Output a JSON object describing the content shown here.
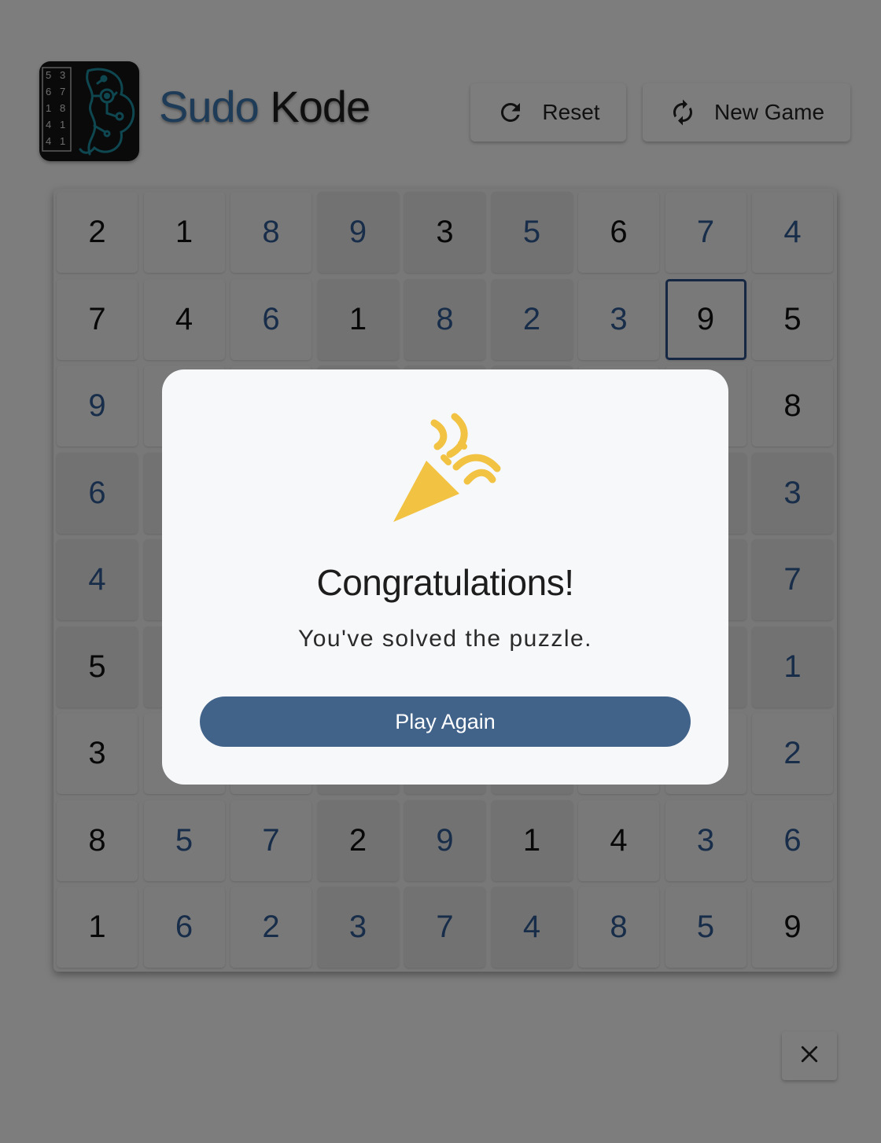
{
  "header": {
    "brand_part1": "Sudo",
    "brand_part2": "Kode",
    "reset_label": "Reset",
    "new_game_label": "New Game"
  },
  "logo": {
    "rows": [
      [
        "5",
        "3"
      ],
      [
        "6",
        "7"
      ],
      [
        "1",
        "8"
      ],
      [
        "4",
        "1"
      ],
      [
        "4",
        "1"
      ]
    ]
  },
  "board": {
    "values": [
      [
        2,
        1,
        8,
        9,
        3,
        5,
        6,
        7,
        4
      ],
      [
        7,
        4,
        6,
        1,
        8,
        2,
        3,
        9,
        5
      ],
      [
        9,
        null,
        null,
        null,
        null,
        null,
        null,
        null,
        8
      ],
      [
        6,
        null,
        null,
        null,
        null,
        null,
        null,
        null,
        3
      ],
      [
        4,
        null,
        null,
        null,
        null,
        null,
        null,
        null,
        7
      ],
      [
        5,
        null,
        null,
        null,
        null,
        null,
        null,
        null,
        1
      ],
      [
        3,
        null,
        null,
        null,
        null,
        null,
        null,
        null,
        2
      ],
      [
        8,
        5,
        7,
        2,
        9,
        1,
        4,
        3,
        6
      ],
      [
        1,
        6,
        2,
        3,
        7,
        4,
        8,
        5,
        9
      ]
    ],
    "given": [
      [
        1,
        1,
        0,
        0,
        1,
        0,
        1,
        0,
        0
      ],
      [
        1,
        1,
        0,
        1,
        0,
        0,
        0,
        1,
        1
      ],
      [
        0,
        0,
        0,
        0,
        0,
        0,
        0,
        0,
        1
      ],
      [
        0,
        0,
        0,
        0,
        0,
        0,
        0,
        0,
        0
      ],
      [
        0,
        0,
        0,
        0,
        0,
        0,
        0,
        0,
        0
      ],
      [
        1,
        0,
        0,
        0,
        0,
        0,
        0,
        0,
        0
      ],
      [
        1,
        0,
        0,
        0,
        0,
        0,
        0,
        0,
        0
      ],
      [
        1,
        0,
        0,
        1,
        0,
        1,
        1,
        0,
        0
      ],
      [
        1,
        0,
        0,
        0,
        0,
        0,
        0,
        0,
        1
      ]
    ],
    "selected": [
      1,
      7
    ],
    "colors": {
      "given": "#111111",
      "entered": "#2f5a92",
      "selected_border": "#2b4f86"
    }
  },
  "modal": {
    "icon": "party-popper-icon",
    "title": "Congratulations!",
    "message": "You've solved the puzzle.",
    "play_again_label": "Play Again",
    "colors": {
      "button": "#416289",
      "popper": "#f2c242"
    }
  },
  "close_icon": "close-icon"
}
